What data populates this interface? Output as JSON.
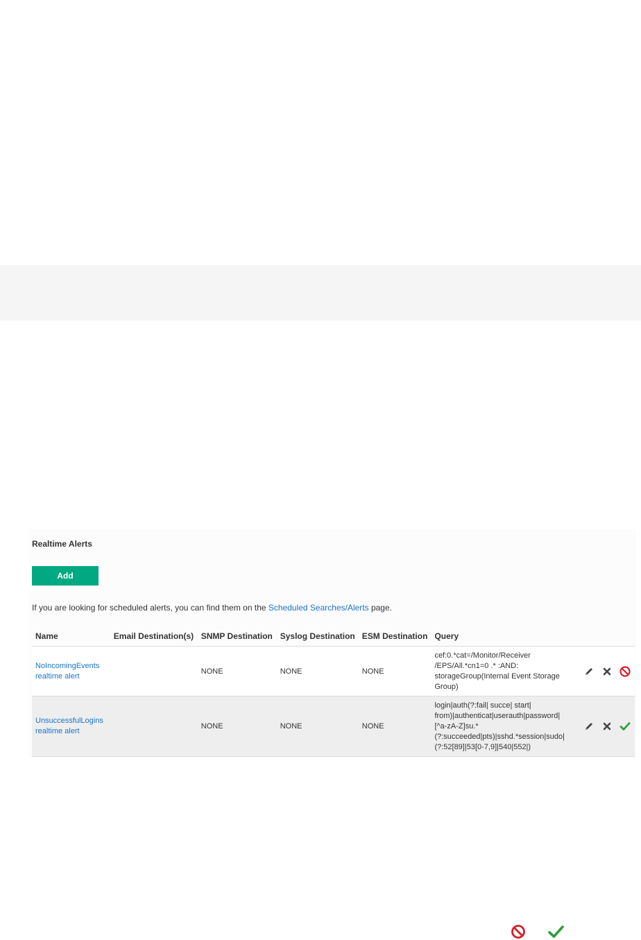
{
  "panel": {
    "title": "Realtime Alerts",
    "add_label": "Add",
    "info_prefix": "If you are looking for scheduled alerts, you can find them on the ",
    "info_link": "Scheduled Searches/Alerts",
    "info_suffix": " page."
  },
  "table": {
    "headers": [
      "Name",
      "Email Destination(s)",
      "SNMP Destination",
      "Syslog Destination",
      "ESM Destination",
      "Query"
    ],
    "rows": [
      {
        "name": "NoIncomingEvents",
        "subtitle": "realtime alert",
        "email": "",
        "snmp": "NONE",
        "syslog": "NONE",
        "esm": "NONE",
        "query_lines": [
          "cef:0.*cat=/Monitor/Receiver",
          "/EPS/All.*cn1=0 .* :AND:",
          "storageGroup(Internal Event Storage",
          "Group)"
        ],
        "status_icon": "disable-icon"
      },
      {
        "name": "UnsuccessfulLogins",
        "subtitle": "realtime alert",
        "email": "",
        "snmp": "NONE",
        "syslog": "NONE",
        "esm": "NONE",
        "query_lines": [
          "login|auth(?:fail| succe| start|",
          "from)|authenticat|userauth|password|",
          "[^a-zA-Z]su.*",
          "(?:succeeded|pts)|sshd.*session|sudo|",
          "(?:52[89]|53[0-7,9]|540|552|)"
        ],
        "status_icon": "enabled-check-icon"
      }
    ]
  },
  "colors": {
    "accent_green": "#01a982",
    "link_blue": "#1a73c8",
    "disable_red": "#d3202a",
    "check_green": "#2e9e3e"
  }
}
